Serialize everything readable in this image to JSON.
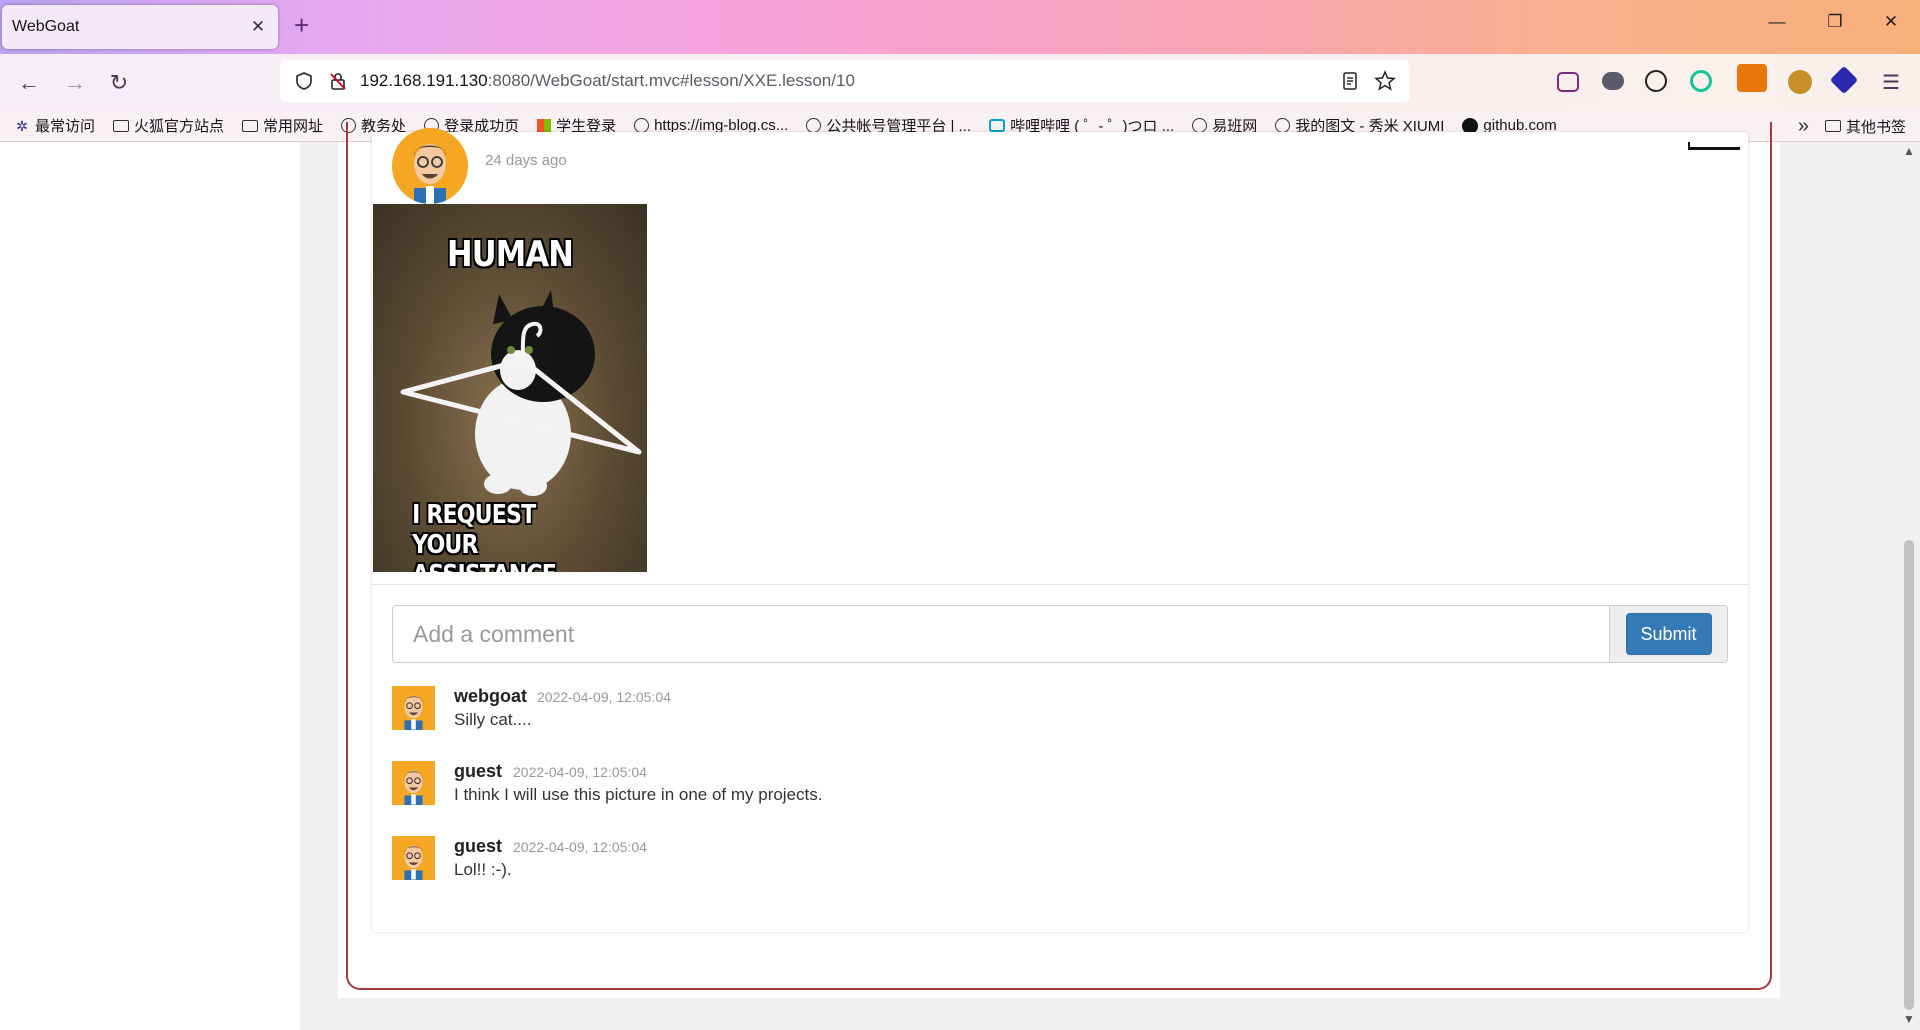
{
  "browser": {
    "tab_title": "WebGoat",
    "tab_close": "✕",
    "new_tab": "+",
    "url_host": "192.168.191.130",
    "url_rest": ":8080/WebGoat/start.mvc#lesson/XXE.lesson/10",
    "minimize": "—",
    "restore": "❐",
    "close": "✕"
  },
  "bookmarks": {
    "items": [
      {
        "label": "最常访问",
        "icon": "gear-icon"
      },
      {
        "label": "火狐官方站点",
        "icon": "folder-icon"
      },
      {
        "label": "常用网址",
        "icon": "folder-icon"
      },
      {
        "label": "教务处",
        "icon": "globe-icon"
      },
      {
        "label": "登录成功页",
        "icon": "globe-icon"
      },
      {
        "label": "学生登录",
        "icon": "windows-icon"
      },
      {
        "label": "https://img-blog.cs...",
        "icon": "globe-icon"
      },
      {
        "label": "公共帐号管理平台 | ...",
        "icon": "globe-icon"
      },
      {
        "label": "哔哩哔哩 ( ゜- ゜)つロ ...",
        "icon": "bilibili-icon"
      },
      {
        "label": "易班网",
        "icon": "globe-icon"
      },
      {
        "label": "我的图文 - 秀米 XIUMI",
        "icon": "globe-icon"
      },
      {
        "label": "github.com",
        "icon": "github-icon"
      }
    ],
    "overflow": "»",
    "other": "其他书签"
  },
  "post": {
    "time": "24 days ago",
    "meme_top": "HUMAN",
    "meme_bottom_1": "I REQUEST YOUR",
    "meme_bottom_2": "ASSISTANCE"
  },
  "comment_form": {
    "placeholder": "Add a comment",
    "submit": "Submit"
  },
  "comments": [
    {
      "user": "webgoat",
      "date": "2022-04-09, 12:05:04",
      "text": "Silly cat...."
    },
    {
      "user": "guest",
      "date": "2022-04-09, 12:05:04",
      "text": "I think I will use this picture in one of my projects."
    },
    {
      "user": "guest",
      "date": "2022-04-09, 12:05:04",
      "text": "Lol!! :-)."
    }
  ]
}
